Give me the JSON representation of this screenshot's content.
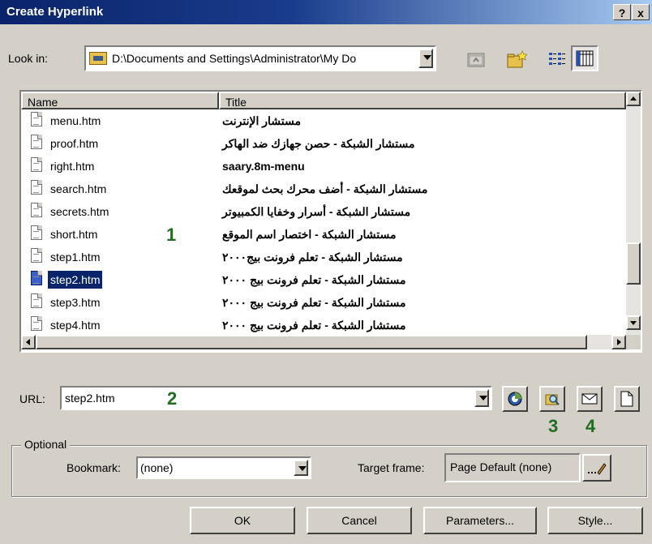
{
  "window": {
    "title": "Create Hyperlink",
    "help_label": "?",
    "close_label": "x"
  },
  "lookin": {
    "label": "Look in:",
    "value": "D:\\Documents and Settings\\Administrator\\My Do"
  },
  "toolbar_icons": [
    "up-folder-icon",
    "new-folder-icon",
    "list-view-icon",
    "details-view-icon"
  ],
  "list": {
    "columns": {
      "name": "Name",
      "title": "Title"
    },
    "rows": [
      {
        "name": "menu.htm",
        "title": "مستشار الإنترنت",
        "selected": false
      },
      {
        "name": "proof.htm",
        "title": "مستشار الشبكة - حصن جهازك ضد الهاكر",
        "selected": false
      },
      {
        "name": "right.htm",
        "title": "saary.8m-menu",
        "selected": false
      },
      {
        "name": "search.htm",
        "title": "مستشار الشبكة - أضف محرك بحث لموقعك",
        "selected": false
      },
      {
        "name": "secrets.htm",
        "title": "مستشار الشبكة - أسرار وخفايا الكمبيوتر",
        "selected": false
      },
      {
        "name": "short.htm",
        "title": "مستشار الشبكة - اختصار اسم الموقع",
        "selected": false
      },
      {
        "name": "step1.htm",
        "title": "مستشار الشبكة - تعلم فرونت بيج٢٠٠٠",
        "selected": false
      },
      {
        "name": "step2.htm",
        "title": "مستشار الشبكة - تعلم فرونت بيج ٢٠٠٠",
        "selected": true
      },
      {
        "name": "step3.htm",
        "title": "مستشار الشبكة - تعلم فرونت بيج ٢٠٠٠",
        "selected": false
      },
      {
        "name": "step4.htm",
        "title": "مستشار الشبكة - تعلم فرونت بيج ٢٠٠٠",
        "selected": false
      }
    ]
  },
  "url": {
    "label": "URL:",
    "value": "step2.htm"
  },
  "url_buttons": [
    "web-browse-icon",
    "browse-file-icon",
    "email-icon",
    "new-page-icon"
  ],
  "annotations": {
    "a1": "1",
    "a2": "2",
    "a3": "3",
    "a4": "4"
  },
  "optional": {
    "legend": "Optional",
    "bookmark_label": "Bookmark:",
    "bookmark_value": "(none)",
    "target_label": "Target frame:",
    "target_value": "Page Default (none)"
  },
  "buttons": {
    "ok": "OK",
    "cancel": "Cancel",
    "parameters": "Parameters...",
    "style": "Style..."
  },
  "colors": {
    "selection": "#0a246a",
    "annotation": "#1e6e1e",
    "face": "#d4d0c8"
  }
}
